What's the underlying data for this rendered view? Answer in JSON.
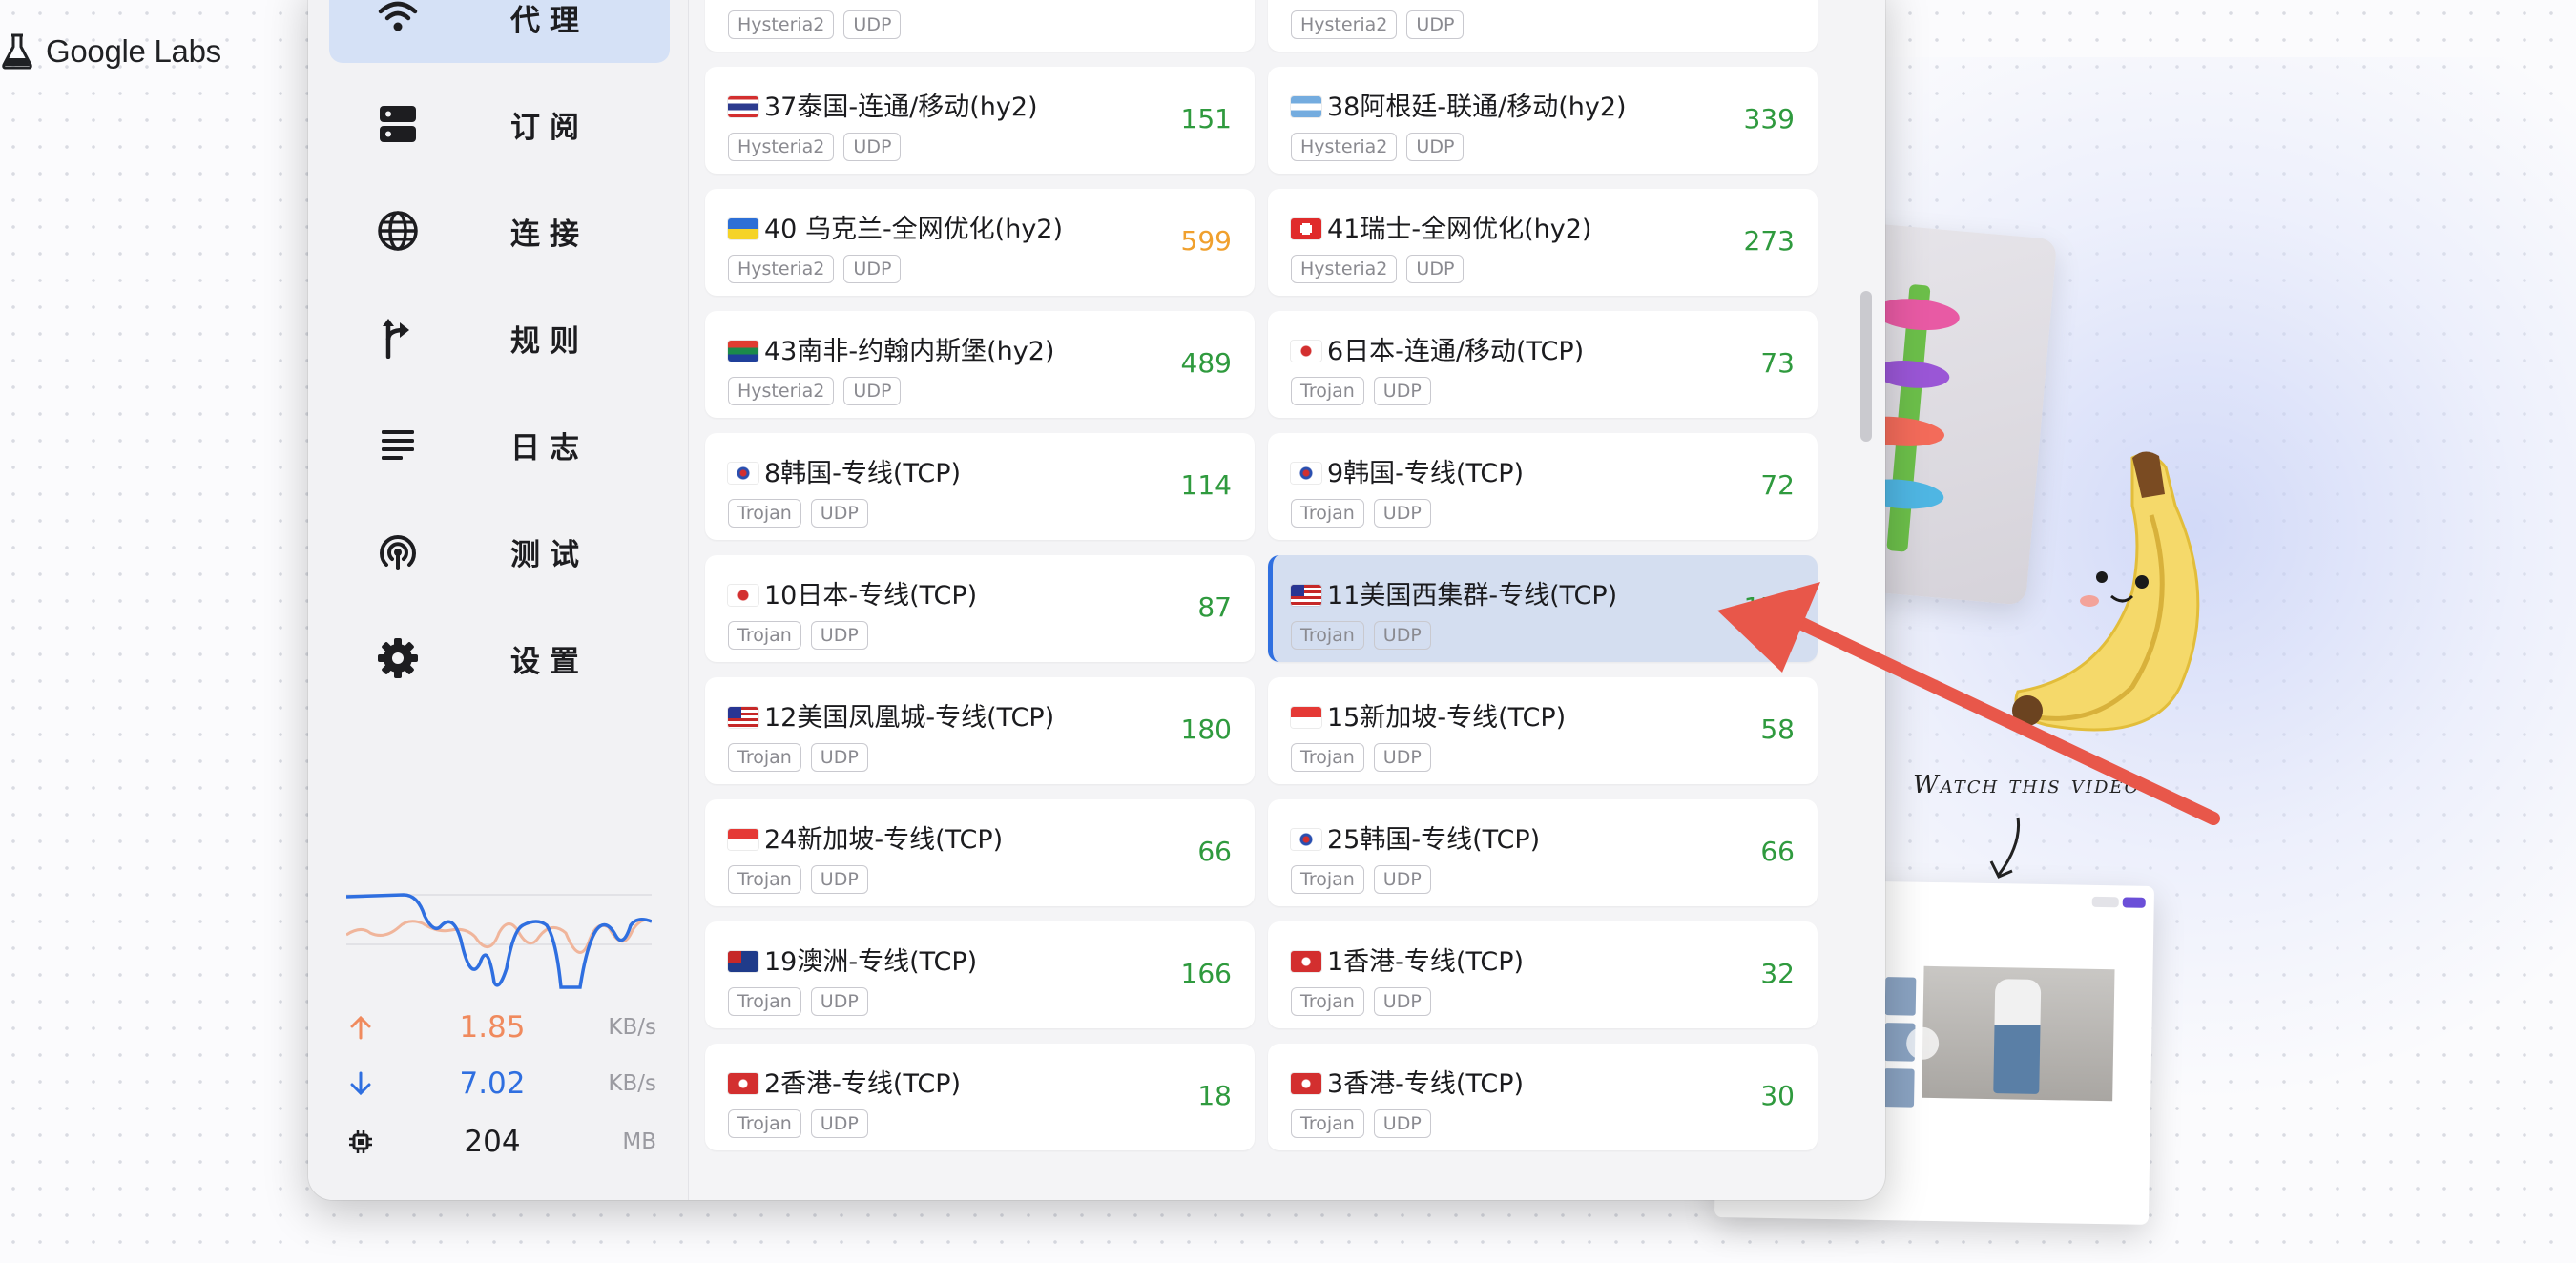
{
  "brand": {
    "name": "Google Labs"
  },
  "background": {
    "caption": "Watch this video"
  },
  "sidebar": {
    "nav": [
      {
        "label": "代理",
        "icon": "wifi-icon",
        "active": true
      },
      {
        "label": "订阅",
        "icon": "server-icon",
        "active": false
      },
      {
        "label": "连接",
        "icon": "globe-icon",
        "active": false
      },
      {
        "label": "规则",
        "icon": "route-icon",
        "active": false
      },
      {
        "label": "日志",
        "icon": "list-lines-icon",
        "active": false
      },
      {
        "label": "测试",
        "icon": "broadcast-icon",
        "active": false
      },
      {
        "label": "设置",
        "icon": "gear-icon",
        "active": false
      }
    ],
    "stats": {
      "upload": {
        "value": "1.85",
        "unit": "KB/s",
        "color": "#f08a5d"
      },
      "download": {
        "value": "7.02",
        "unit": "KB/s",
        "color": "#2f6fe0"
      },
      "memory": {
        "value": "204",
        "unit": "MB"
      }
    }
  },
  "proxies": [
    {
      "name": "",
      "tags": [
        "Hysteria2",
        "UDP"
      ],
      "latency": "",
      "flag": ""
    },
    {
      "name": "",
      "tags": [
        "Hysteria2",
        "UDP"
      ],
      "latency": "",
      "flag": ""
    },
    {
      "name": "37泰国-连通/移动(hy2)",
      "tags": [
        "Hysteria2",
        "UDP"
      ],
      "latency": "151",
      "flag": "TH"
    },
    {
      "name": "38阿根廷-联通/移动(hy2)",
      "tags": [
        "Hysteria2",
        "UDP"
      ],
      "latency": "339",
      "flag": "AR"
    },
    {
      "name": "40 乌克兰-全网优化(hy2)",
      "tags": [
        "Hysteria2",
        "UDP"
      ],
      "latency": "599",
      "flag": "UA",
      "warn": true
    },
    {
      "name": "41瑞士-全网优化(hy2)",
      "tags": [
        "Hysteria2",
        "UDP"
      ],
      "latency": "273",
      "flag": "CH"
    },
    {
      "name": "43南非-约翰内斯堡(hy2)",
      "tags": [
        "Hysteria2",
        "UDP"
      ],
      "latency": "489",
      "flag": "ZA"
    },
    {
      "name": "6日本-连通/移动(TCP)",
      "tags": [
        "Trojan",
        "UDP"
      ],
      "latency": "73",
      "flag": "JP"
    },
    {
      "name": "8韩国-专线(TCP)",
      "tags": [
        "Trojan",
        "UDP"
      ],
      "latency": "114",
      "flag": "KR"
    },
    {
      "name": "9韩国-专线(TCP)",
      "tags": [
        "Trojan",
        "UDP"
      ],
      "latency": "72",
      "flag": "KR"
    },
    {
      "name": "10日本-专线(TCP)",
      "tags": [
        "Trojan",
        "UDP"
      ],
      "latency": "87",
      "flag": "JP"
    },
    {
      "name": "11美国西集群-专线(TCP)",
      "tags": [
        "Trojan",
        "UDP"
      ],
      "latency": "172",
      "flag": "US",
      "selected": true
    },
    {
      "name": "12美国凤凰城-专线(TCP)",
      "tags": [
        "Trojan",
        "UDP"
      ],
      "latency": "180",
      "flag": "US"
    },
    {
      "name": "15新加坡-专线(TCP)",
      "tags": [
        "Trojan",
        "UDP"
      ],
      "latency": "58",
      "flag": "SG"
    },
    {
      "name": "24新加坡-专线(TCP)",
      "tags": [
        "Trojan",
        "UDP"
      ],
      "latency": "66",
      "flag": "SG"
    },
    {
      "name": "25韩国-专线(TCP)",
      "tags": [
        "Trojan",
        "UDP"
      ],
      "latency": "66",
      "flag": "KR"
    },
    {
      "name": "19澳洲-专线(TCP)",
      "tags": [
        "Trojan",
        "UDP"
      ],
      "latency": "166",
      "flag": "AU"
    },
    {
      "name": "1香港-专线(TCP)",
      "tags": [
        "Trojan",
        "UDP"
      ],
      "latency": "32",
      "flag": "HK"
    },
    {
      "name": "2香港-专线(TCP)",
      "tags": [
        "Trojan",
        "UDP"
      ],
      "latency": "18",
      "flag": "HK"
    },
    {
      "name": "3香港-专线(TCP)",
      "tags": [
        "Trojan",
        "UDP"
      ],
      "latency": "30",
      "flag": "HK"
    }
  ],
  "colors": {
    "accent": "#2f6fe0",
    "active_nav_bg": "#d5e1f6",
    "latency_ok": "#2f9a3e",
    "latency_warn": "#f0a02d",
    "annotation_arrow": "#e8574a"
  }
}
